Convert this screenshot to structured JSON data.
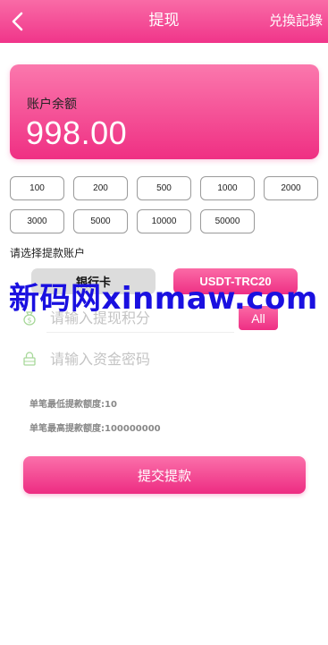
{
  "header": {
    "title": "提现",
    "right_link": "兑換記錄",
    "back_icon": "chevron-left-icon"
  },
  "balance": {
    "label": "账户余额",
    "value": "998.00"
  },
  "amounts": [
    [
      "100",
      "200",
      "500",
      "1000",
      "2000"
    ],
    [
      "3000",
      "5000",
      "10000",
      "50000"
    ]
  ],
  "account_select": {
    "label": "请选择提款账户",
    "options": [
      "银行卡",
      "USDT-TRC20"
    ],
    "selected": "USDT-TRC20"
  },
  "withdraw_form": {
    "points_placeholder": "请输入提现积分",
    "all_label": "All",
    "password_placeholder": "请输入资金密码",
    "min_limit": "单笔最低提款额度:10",
    "max_limit": "单笔最高提款额度:100000000",
    "submit_label": "提交提款"
  },
  "watermark": "新码网xinmaw.com",
  "colors": {
    "primary_pink": "#f0358a",
    "light_pink": "#fb78ad",
    "watermark_blue": "#1a10e0"
  }
}
